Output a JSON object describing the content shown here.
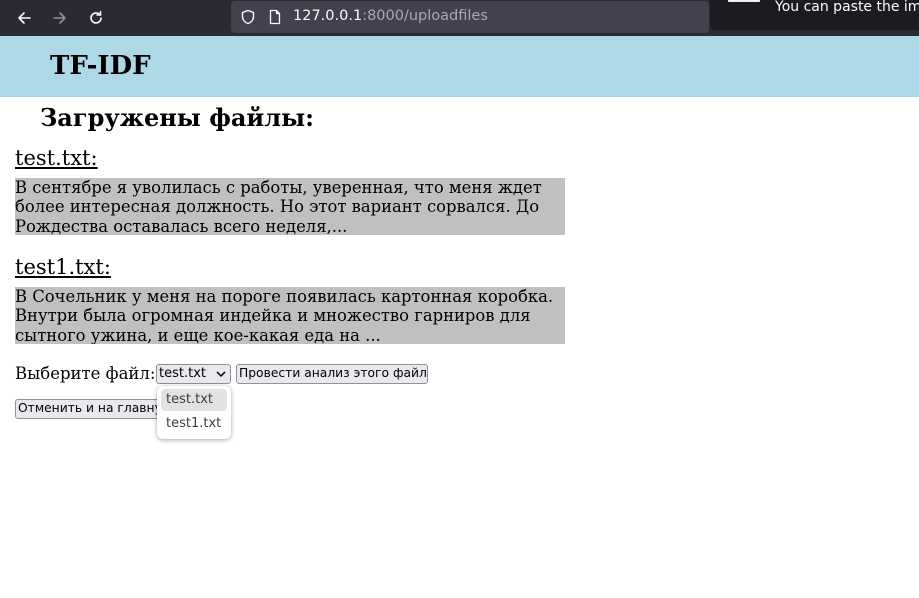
{
  "browser": {
    "url_host": "127.0.0.1",
    "url_rest": ":8000/uploadfiles",
    "notification_text": "You can paste the ima"
  },
  "header": {
    "title": "TF-IDF"
  },
  "main": {
    "heading": "Загружены файлы:",
    "files": [
      {
        "name": "test.txt:",
        "preview": "В сентябре я уволилась с работы, уверенная, что меня ждет\nболее интересная должность. Но этот вариант сорвался. До\nРождества оставалась всего неделя,..."
      },
      {
        "name": "test1.txt:",
        "preview": "В Сочельник у меня на пороге появилась картонная коробка.\nВнутри была огромная индейка и множество гарниров для\nсытного ужина, и еще кое-какая еда на ..."
      }
    ],
    "choose_label": "Выберите файл:",
    "select_value": "test.txt",
    "dropdown_options": [
      "test.txt",
      "test1.txt"
    ],
    "analyze_button": "Провести анализ этого файла",
    "cancel_button": "Отменить и на главную"
  }
}
